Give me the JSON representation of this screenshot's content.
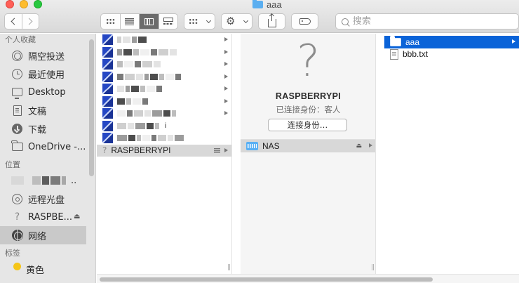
{
  "window": {
    "title": "aaa"
  },
  "toolbar": {
    "search_placeholder": "搜索",
    "back_icon": "chevron-left-icon",
    "forward_icon": "chevron-right-icon"
  },
  "sidebar": {
    "favorites_header": "个人收藏",
    "favorites": [
      {
        "label": "隔空投送",
        "icon": "airdrop-icon"
      },
      {
        "label": "最近使用",
        "icon": "clock-icon"
      },
      {
        "label": "Desktop",
        "icon": "desktop-icon"
      },
      {
        "label": "文稿",
        "icon": "document-icon"
      },
      {
        "label": "下载",
        "icon": "download-icon"
      },
      {
        "label": "OneDrive -...",
        "icon": "folder-icon"
      }
    ],
    "locations_header": "位置",
    "locations": [
      {
        "label": "..",
        "icon": "device-icon"
      },
      {
        "label": "远程光盘",
        "icon": "disc-icon"
      },
      {
        "label": "RASPBE...",
        "icon": "question-icon",
        "eject": "⏏"
      },
      {
        "label": "网络",
        "icon": "network-icon",
        "selected": true
      }
    ],
    "tags_header": "标签",
    "tags": [
      {
        "label": "黄色",
        "color": "#f5c518"
      }
    ]
  },
  "column1": {
    "items": [
      {
        "label": "RASPBERRYPI",
        "selected": true
      }
    ]
  },
  "column2": {
    "server_name": "RASPBERRYPI",
    "status": "已连接身份：客人",
    "connect_button": "连接身份…",
    "items": [
      {
        "label": "NAS",
        "eject": "⏏"
      }
    ]
  },
  "column3": {
    "items": [
      {
        "label": "aaa",
        "type": "folder",
        "selected": true
      },
      {
        "label": "bbb.txt",
        "type": "text-file"
      }
    ]
  },
  "colors": {
    "selection_blue": "#0a63d8",
    "folder_blue": "#5ab0f4",
    "tag_yellow": "#f5c518"
  },
  "misc": {
    "resize_glyph": "||",
    "blur_suffix": "i"
  }
}
